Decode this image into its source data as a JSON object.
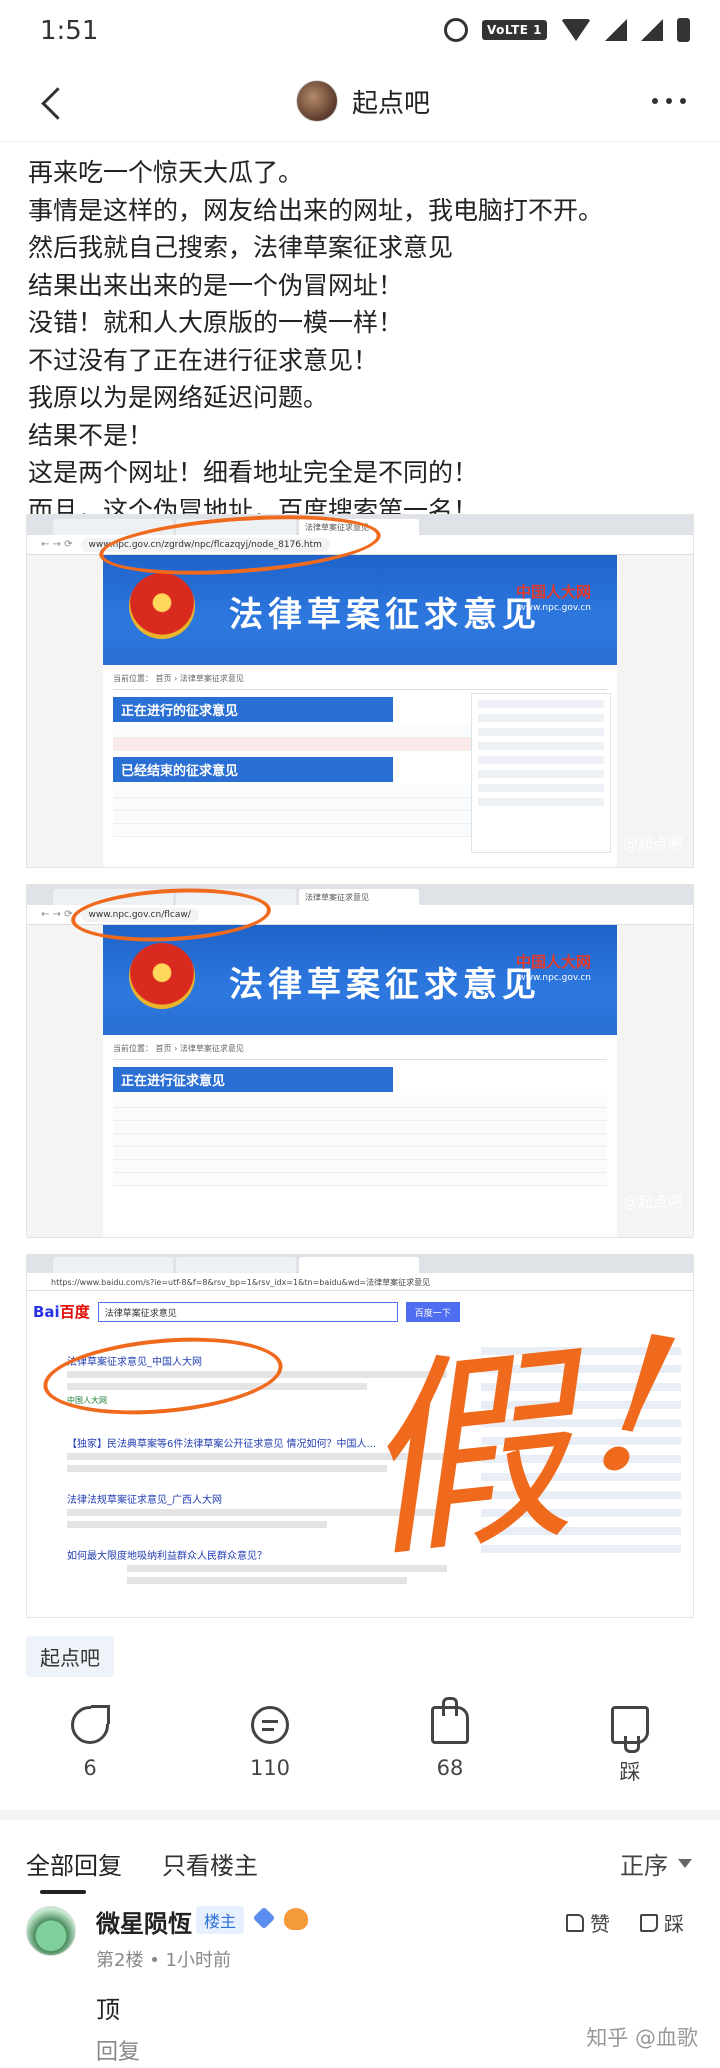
{
  "status_bar": {
    "time": "1:51",
    "network": "VoLTE 1"
  },
  "header": {
    "title": "起点吧"
  },
  "post": {
    "lines": [
      "再来吃一个惊天大瓜了。",
      "事情是这样的，网友给出来的网址，我电脑打不开。",
      "然后我就自己搜索，法律草案征求意见",
      "结果出来出来的是一个伪冒网址！",
      "没错！就和人大原版的一模一样！",
      "不过没有了正在进行征求意见！",
      "我原以为是网络延迟问题。",
      "结果不是！",
      "这是两个网址！细看地址完全是不同的！",
      "而且，这个伪冒地址，百度搜索第一名！"
    ]
  },
  "images": [
    {
      "url": "www.npc.gov.cn/zgrdw/npc/flcazqyj/node_8176.htm",
      "banner_title": "法律草案征求意见",
      "logo": "中国人大网",
      "logo_sub": "www.npc.gov.cn",
      "section1": "正在进行的征求意见",
      "section2": "已经结束的征求意见",
      "watermark": "@起点吧"
    },
    {
      "url": "www.npc.gov.cn/flcaw/",
      "banner_title": "法律草案征求意见",
      "logo": "中国人大网",
      "logo_sub": "www.npc.gov.cn",
      "section1": "正在进行征求意见",
      "watermark": "@起点吧"
    },
    {
      "url": "https://www.baidu.com/s?ie=utf-8&f=8&rsv_bp=1&rsv_idx=1&tn=baidu&wd=法律草案征求意见",
      "logo": "Bai",
      "logo_accent": "百度",
      "query": "法律草案征求意见",
      "search_button": "百度一下",
      "result1": "法律草案征求意见_中国人大网",
      "result1_source": "中国人大网",
      "result2": "法律法规草案征求意见_广西人大网",
      "result3": "【独家】民法典草案等6件法律草案公开征求意见 情况如何？中国人...",
      "result4": "如何最大限度地吸纳利益群众人民群众意见？",
      "annotation": "假",
      "annotation_mark": "!"
    }
  ],
  "topic_tag": "起点吧",
  "actions": {
    "share_count": "6",
    "comment_count": "110",
    "like_count": "68",
    "dislike_label": "踩"
  },
  "comment_tabs": {
    "all": "全部回复",
    "op_only": "只看楼主",
    "sort": "正序"
  },
  "comment": {
    "author": "微星陨恆",
    "badge": "楼主",
    "floor": "第2楼",
    "time": "1小时前",
    "body": "顶",
    "reply": "回复",
    "like": "赞",
    "dislike": "踩"
  },
  "site_watermark": "知乎 @血歌",
  "colors": {
    "annotation": "#f06a1e",
    "npc_blue": "#2a6fd4",
    "link": "#2440b3"
  }
}
